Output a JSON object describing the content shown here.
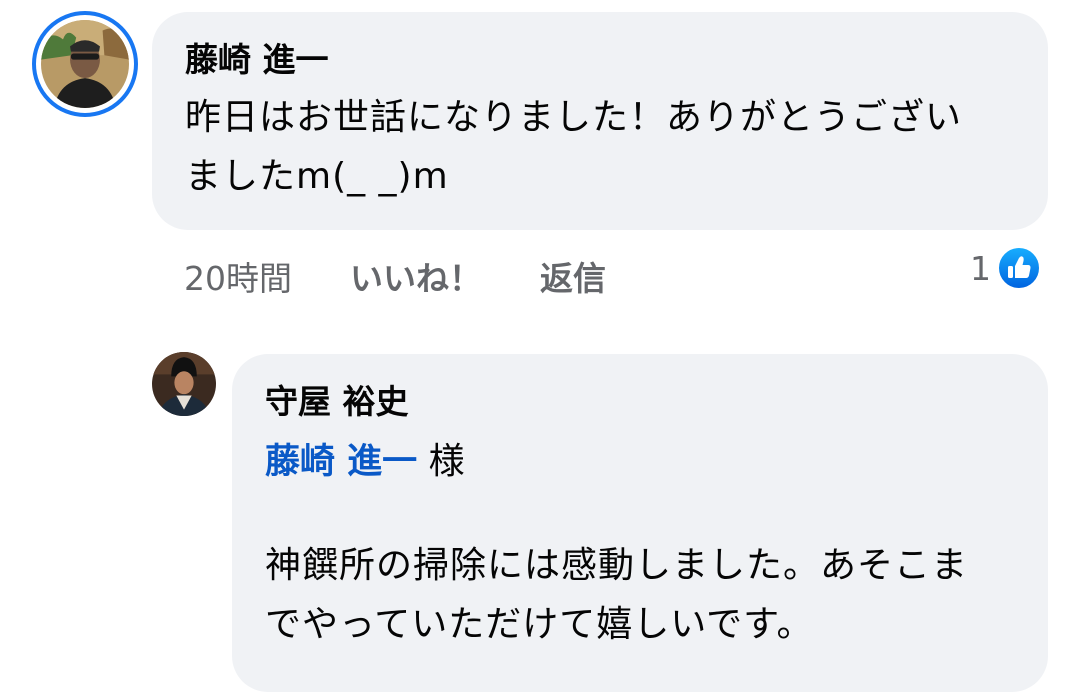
{
  "comment": {
    "author": "藤崎 進一",
    "text": "昨日はお世話になりました！ありがとうございましたm(_ _)m",
    "time": "20時間",
    "like_label": "いいね！",
    "reply_label": "返信",
    "reaction_count": "1",
    "reaction_icon": "thumbs-up-icon"
  },
  "reply": {
    "author": "守屋 裕史",
    "mention": "藤崎 進一",
    "mention_suffix": " 様",
    "text": "神饌所の掃除には感動しました。あそこまでやっていただけて嬉しいです。"
  },
  "colors": {
    "accent": "#1877f2",
    "mention": "#0a59c7",
    "bubble": "#f0f2f5",
    "meta": "#65676b"
  }
}
